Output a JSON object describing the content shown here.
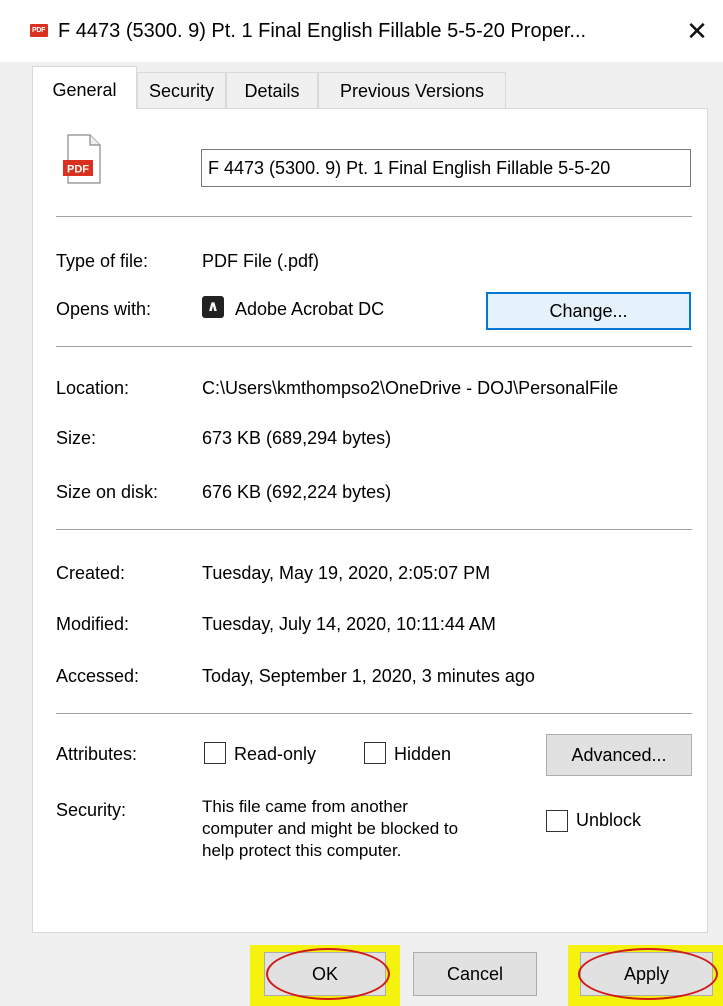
{
  "window": {
    "title": "F 4473 (5300. 9) Pt. 1 Final English Fillable 5-5-20 Proper...",
    "close_glyph": "✕",
    "title_icon_text": "PDF"
  },
  "tabs": [
    {
      "label": "General",
      "active": true
    },
    {
      "label": "Security",
      "active": false
    },
    {
      "label": "Details",
      "active": false
    },
    {
      "label": "Previous Versions",
      "active": false
    }
  ],
  "file": {
    "icon": "pdf-file-icon",
    "icon_text": "PDF",
    "name": "F 4473 (5300. 9) Pt. 1 Final English Fillable 5-5-20"
  },
  "type": {
    "label": "Type of file:",
    "value": "PDF File (.pdf)"
  },
  "opens": {
    "label": "Opens with:",
    "app": "Adobe Acrobat DC",
    "app_icon": "acrobat-icon",
    "change_label": "Change..."
  },
  "location": {
    "label": "Location:",
    "value": "C:\\Users\\kmthompso2\\OneDrive - DOJ\\PersonalFile"
  },
  "size": {
    "label": "Size:",
    "value": "673 KB (689,294 bytes)"
  },
  "size_on_disk": {
    "label": "Size on disk:",
    "value": "676 KB (692,224 bytes)"
  },
  "created": {
    "label": "Created:",
    "value": "Tuesday, May 19, 2020, 2:05:07 PM"
  },
  "modified": {
    "label": "Modified:",
    "value": "Tuesday, July 14, 2020, 10:11:44 AM"
  },
  "accessed": {
    "label": "Accessed:",
    "value": "Today, September 1, 2020, 3 minutes ago"
  },
  "attributes": {
    "label": "Attributes:",
    "readonly": "Read-only",
    "hidden": "Hidden",
    "advanced": "Advanced..."
  },
  "security": {
    "label": "Security:",
    "line1": "This file came from another",
    "line2": "computer and might be blocked to",
    "line3": "help protect this computer.",
    "unblock": "Unblock"
  },
  "footer": {
    "ok": "OK",
    "cancel": "Cancel",
    "apply": "Apply"
  },
  "colors": {
    "highlight": "#f5f20e",
    "annotation_ring": "#d11a1a",
    "focus": "#0078d7",
    "pdf_red": "#d9301f"
  }
}
